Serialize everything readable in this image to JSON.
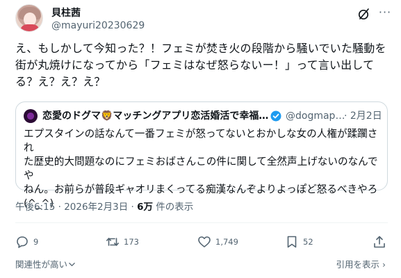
{
  "tweet": {
    "display_name": "貝柱茜",
    "handle": "@mayuri20230629",
    "text_lines": [
      "え、もしかして今知った？！フェミが焚き火の段階から騒いでいた騒動を",
      "街が丸焼けになってから「フェミはなぜ怒らないー！」って言い出して",
      "る？え？え？え？"
    ],
    "timestamp": "午後6:15 · 2026年2月3日 · ",
    "views_count": "6万",
    "views_label": " 件の表示"
  },
  "quote": {
    "name": "恋愛のドグマ🦁マッチングアプリ恋活婚活で幸福…",
    "handle": "@dogmap…",
    "date": "· 2月2日",
    "text_lines": [
      "エプスタインの話なんて一番フェミが怒ってないとおかしな女の人権が蹂躙され",
      "た歴史的大問題なのにフェミおばさんこの件に関して全然声上げないのなんでや",
      "ねん。お前らが普段ギャオリまくってる痴漢なんぞよりよっぽど怒るべきやろ",
      "(^_^)"
    ]
  },
  "actions": {
    "replies": "9",
    "reposts": "173",
    "likes": "1,749",
    "bookmarks": "52"
  },
  "footer": {
    "sort_label": "関連性が高い",
    "quotes_label": "引用を表示 ›"
  },
  "icons": {
    "grok": "grok-icon",
    "more": "more-icon",
    "verified": "verified-icon",
    "reply": "reply-icon",
    "repost": "repost-icon",
    "like": "like-icon",
    "bookmark": "bookmark-icon",
    "share": "share-icon",
    "chevron": "chevron-down-icon"
  },
  "colors": {
    "text": "#0f1419",
    "secondary": "#536471",
    "border": "#cfd9de",
    "verified": "#1d9bf0"
  }
}
